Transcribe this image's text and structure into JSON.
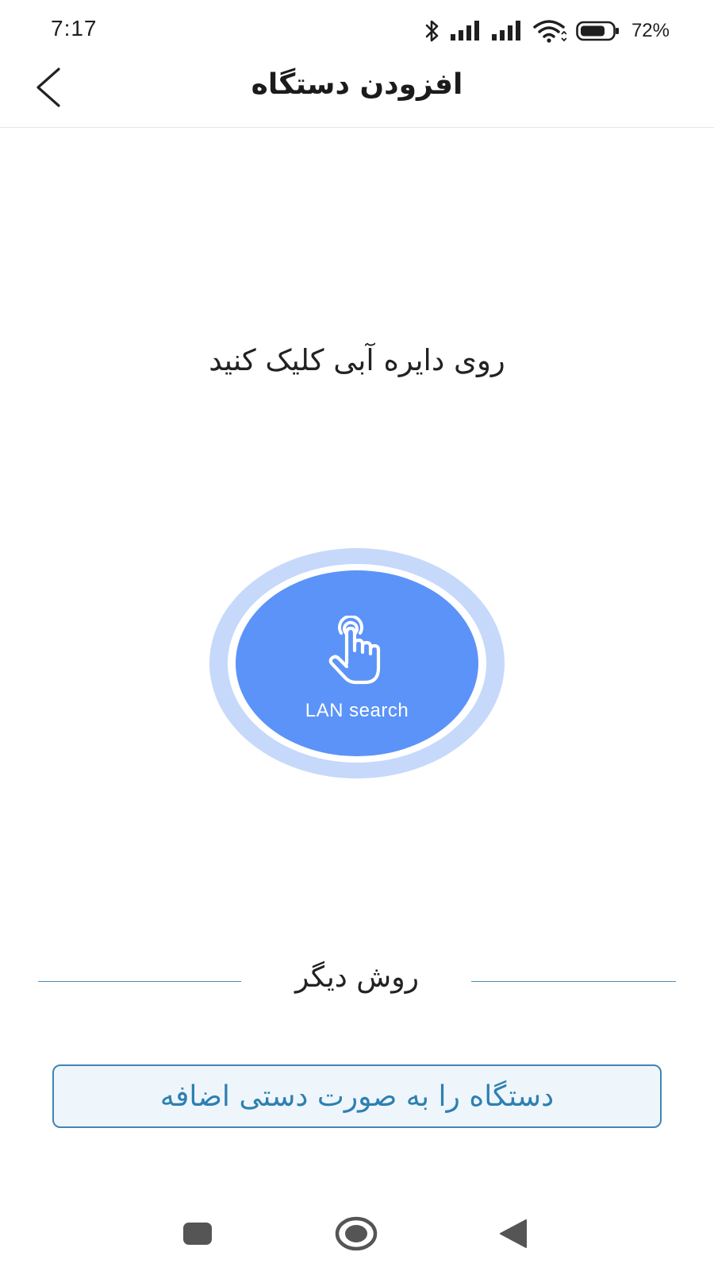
{
  "status_bar": {
    "time": "7:17",
    "battery_percent": "72%",
    "icons": [
      "bluetooth-icon",
      "signal-icon",
      "signal-icon",
      "wifi-icon",
      "battery-icon"
    ]
  },
  "header": {
    "title": "افزودن دستگاه",
    "back_icon": "chevron-left-icon"
  },
  "main": {
    "instruction": "روی دایره آبی کلیک کنید",
    "search_button": {
      "label": "LAN search",
      "icon": "hand-tap-icon"
    },
    "divider_text": "روش دیگر",
    "manual_add_label": "دستگاه را به صورت دستی اضافه"
  },
  "nav_bar": {
    "buttons": [
      "recents-icon",
      "home-icon",
      "back-triangle-icon"
    ]
  },
  "colors": {
    "circle_inner": "#5b93f8",
    "circle_outer": "#c6d9fb",
    "accent": "#2f7fb1",
    "button_bg": "#eef6fb"
  }
}
